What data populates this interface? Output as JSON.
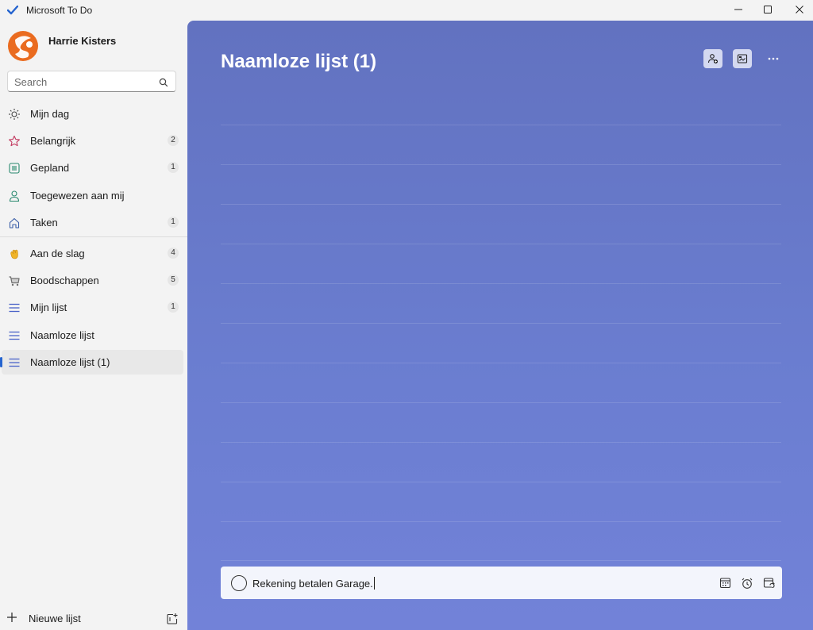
{
  "window": {
    "title": "Microsoft To Do"
  },
  "profile": {
    "name": "Harrie Kisters"
  },
  "search": {
    "placeholder": "Search"
  },
  "sidebar": {
    "items": [
      {
        "label": "Mijn dag",
        "count": "",
        "icon": "sun-icon"
      },
      {
        "label": "Belangrijk",
        "count": "2",
        "icon": "star-icon"
      },
      {
        "label": "Gepland",
        "count": "1",
        "icon": "calendar-icon"
      },
      {
        "label": "Toegewezen aan mij",
        "count": "",
        "icon": "person-icon"
      },
      {
        "label": "Taken",
        "count": "1",
        "icon": "home-icon"
      },
      {
        "label": "Aan de slag",
        "count": "4",
        "icon": "waving-hand-icon"
      },
      {
        "label": "Boodschappen",
        "count": "5",
        "icon": "shopping-cart-icon"
      },
      {
        "label": "Mijn lijst",
        "count": "1",
        "icon": "list-icon"
      },
      {
        "label": "Naamloze lijst",
        "count": "",
        "icon": "list-icon"
      },
      {
        "label": "Naamloze lijst (1)",
        "count": "",
        "icon": "list-icon",
        "active": true
      }
    ],
    "new_list_label": "Nieuwe lijst"
  },
  "main": {
    "title": "Naamloze lijst (1)",
    "add_task": {
      "value": "Rekening betalen Garage."
    }
  },
  "colors": {
    "accent": "#2564cf",
    "main_bg_top": "#6272c0",
    "main_bg_bottom": "#7282d8",
    "sidebar_bg": "#f3f3f3"
  }
}
